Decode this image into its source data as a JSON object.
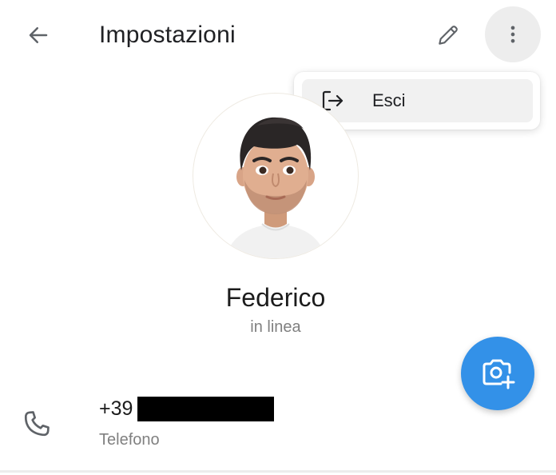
{
  "header": {
    "title": "Impostazioni",
    "back_icon": "arrow-left-icon",
    "edit_icon": "pencil-icon",
    "more_icon": "more-vertical-icon"
  },
  "menu": {
    "items": [
      {
        "label": "Esci",
        "icon": "logout-icon"
      }
    ]
  },
  "profile": {
    "name": "Federico",
    "status": "in linea",
    "avatar": "memoji-avatar"
  },
  "fab": {
    "icon": "camera-add-icon",
    "color": "#3391e8"
  },
  "contact": {
    "phone_prefix": "+39",
    "phone_redacted": true,
    "phone_label": "Telefono",
    "icon": "phone-icon"
  },
  "colors": {
    "accent": "#3391e8",
    "text": "#202124",
    "secondary_text": "#808080",
    "more_button_bg": "#ededed",
    "menu_item_bg": "#f1f1f1"
  }
}
